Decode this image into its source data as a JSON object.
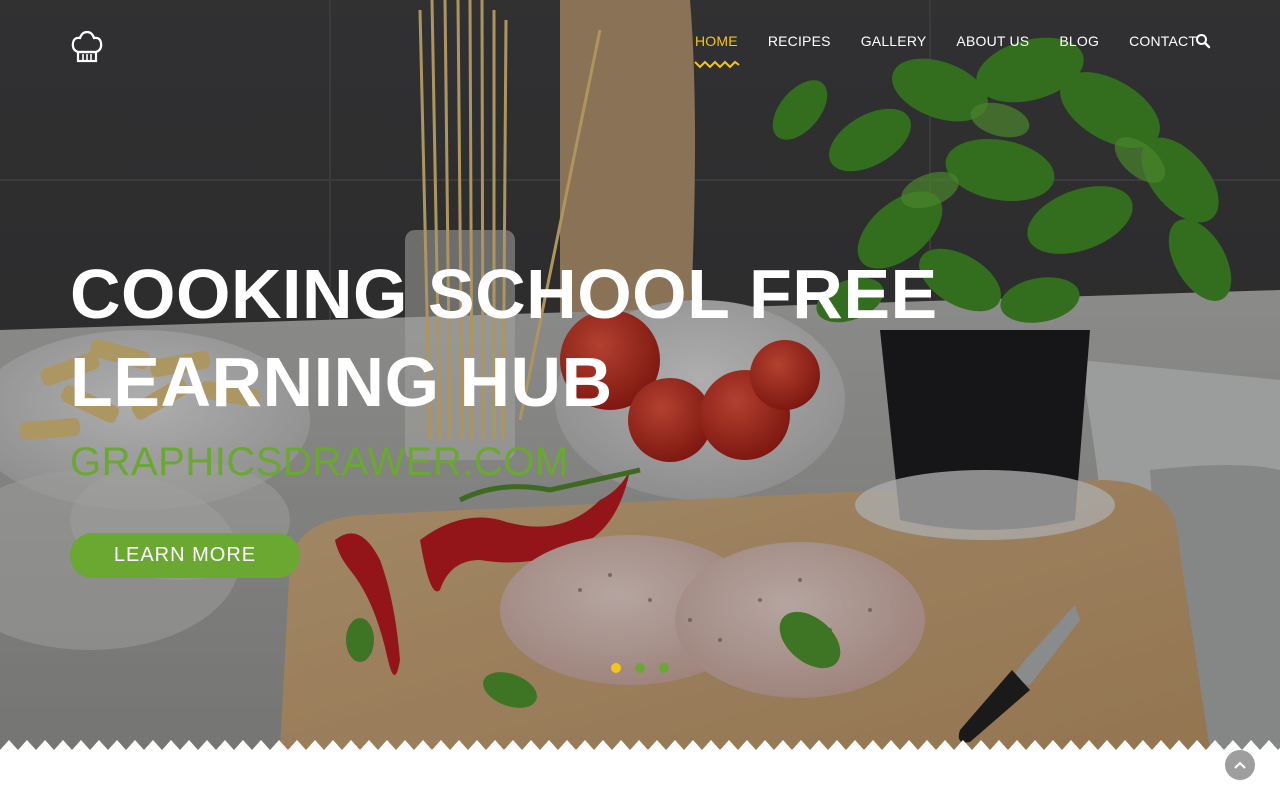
{
  "header": {
    "logo_icon": "chef-hat-icon",
    "nav": [
      {
        "label": "HOME",
        "active": true
      },
      {
        "label": "RECIPES",
        "active": false
      },
      {
        "label": "GALLERY",
        "active": false
      },
      {
        "label": "ABOUT US",
        "active": false
      },
      {
        "label": "BLOG",
        "active": false
      },
      {
        "label": "CONTACT",
        "active": false
      }
    ],
    "search_icon": "search-icon"
  },
  "hero": {
    "title_line1": "COOKING SCHOOL FREE",
    "title_line2": "LEARNING HUB",
    "subtitle": "GRAPHICSDRAWER.COM",
    "cta_label": "LEARN MORE",
    "slides": 3,
    "active_slide": 1
  },
  "colors": {
    "accent_yellow": "#f5c518",
    "accent_green": "#6aa832",
    "text_white": "#ffffff"
  },
  "back_to_top_icon": "chevron-up-icon"
}
